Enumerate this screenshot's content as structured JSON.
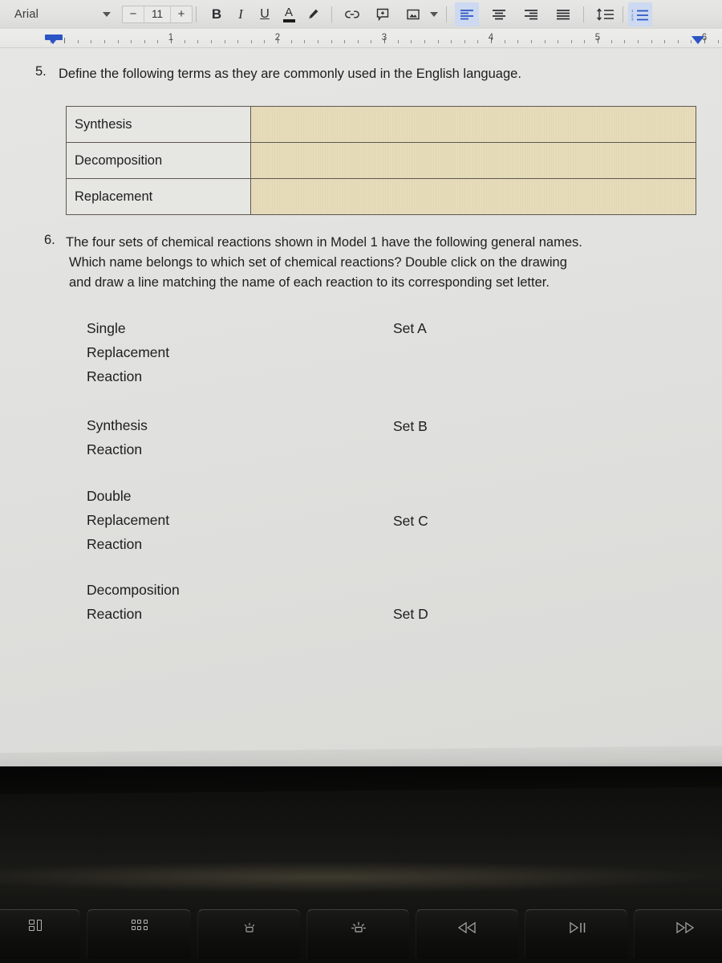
{
  "app": {
    "toolbar": {
      "font_name": "Arial",
      "font_name_dropdown_icon": "chevron-down-icon",
      "font_size_decrease": "−",
      "font_size_value": "11",
      "font_size_increase": "+",
      "bold_label": "B",
      "italic_label": "I",
      "underline_label": "U",
      "text_color_label": "A",
      "text_color_swatch": "#1b1b1b",
      "highlight_icon": "highlighter-pen-icon",
      "link_icon": "insert-link-icon",
      "comment_icon": "add-comment-icon",
      "image_icon": "insert-image-icon",
      "image_dropdown_icon": "chevron-down-icon",
      "align_left_icon": "align-left-icon",
      "align_center_icon": "align-center-icon",
      "align_right_icon": "align-right-icon",
      "align_justify_icon": "align-justify-icon",
      "line_spacing_icon": "line-spacing-icon",
      "list_icon": "numbered-list-icon",
      "active_alignment": "align-left",
      "accent_color": "#2b55c4"
    },
    "ruler": {
      "numbers": [
        "1",
        "2",
        "3",
        "4",
        "5",
        "6"
      ],
      "left_indent_icon": "left-indent-marker",
      "first_line_indent_icon": "first-line-indent-marker",
      "right_indent_icon": "right-indent-marker"
    }
  },
  "document": {
    "question5": {
      "number": "5.",
      "text": "Define the following terms as they are commonly used in the English language.",
      "table": {
        "rows": [
          {
            "term": "Synthesis",
            "answer": ""
          },
          {
            "term": "Decomposition",
            "answer": ""
          },
          {
            "term": "Replacement",
            "answer": ""
          }
        ],
        "answer_cell_color": "#e3d7b3"
      }
    },
    "question6": {
      "number": "6.",
      "line1": "The four sets of chemical reactions shown in Model 1 have the following general names.",
      "line2": "Which name belongs to which set of chemical reactions?  Double click on the drawing",
      "line3": "and draw a line matching the name of each reaction to its corresponding set letter.",
      "matching": [
        {
          "name_line1": "Single",
          "name_line2": "Replacement",
          "name_line3": "Reaction",
          "set": "Set A"
        },
        {
          "name_line1": "Synthesis",
          "name_line2": "Reaction",
          "name_line3": "",
          "set": "Set B"
        },
        {
          "name_line1": "Double",
          "name_line2": "Replacement",
          "name_line3": "Reaction",
          "set": "Set C"
        },
        {
          "name_line1": "Decomposition",
          "name_line2": "Reaction",
          "name_line3": "",
          "set": "Set D"
        }
      ]
    }
  },
  "laptop": {
    "function_keys": [
      {
        "glyph": "mission-control-icon"
      },
      {
        "glyph": "launchpad-grid-icon"
      },
      {
        "glyph": "keyboard-brightness-down-icon"
      },
      {
        "glyph": "keyboard-brightness-up-icon"
      },
      {
        "glyph": "rewind-icon",
        "label": "◁◁"
      },
      {
        "glyph": "play-pause-icon",
        "label": "▷||"
      },
      {
        "glyph": "fast-forward-icon",
        "label": "▷"
      }
    ]
  }
}
